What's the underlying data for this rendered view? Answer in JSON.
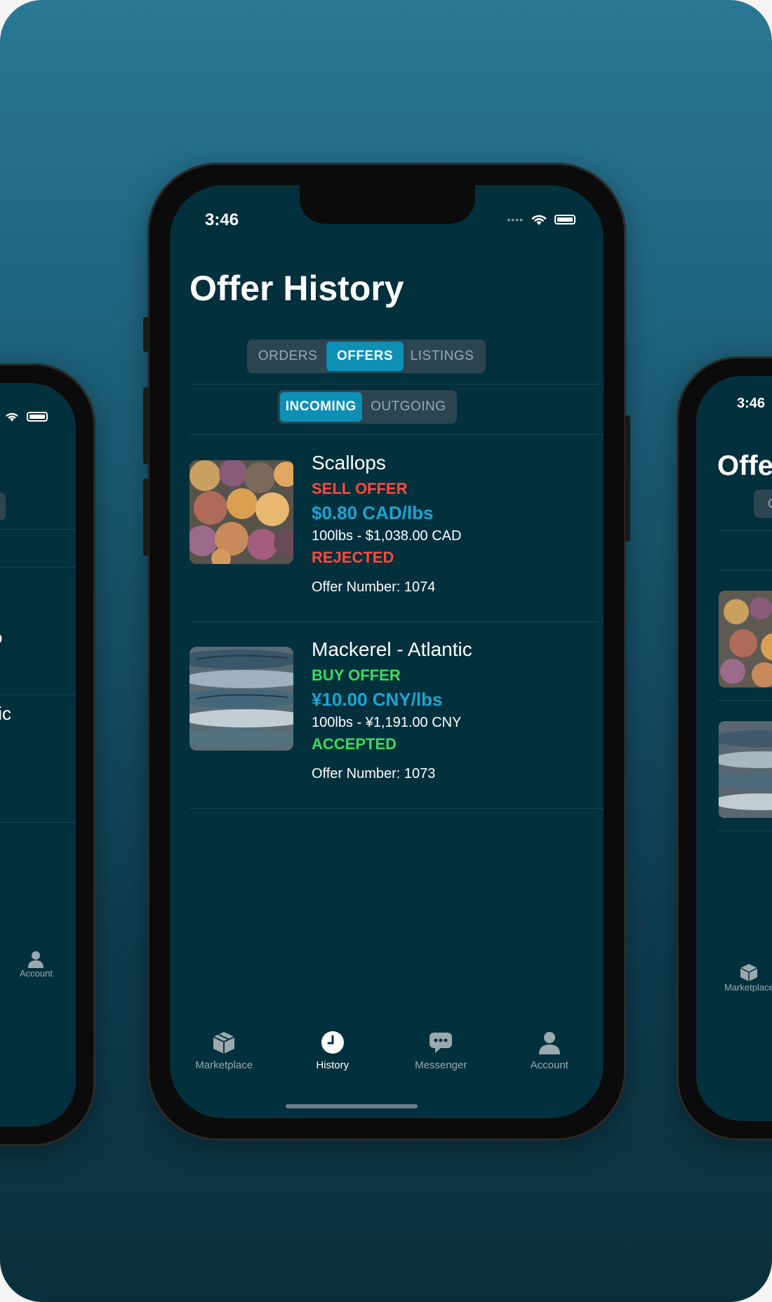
{
  "status": {
    "time": "3:46"
  },
  "page": {
    "title": "Offer History"
  },
  "tabs_main": [
    {
      "label": "ORDERS",
      "active": false
    },
    {
      "label": "OFFERS",
      "active": true
    },
    {
      "label": "LISTINGS",
      "active": false
    }
  ],
  "tabs_sub": [
    {
      "label": "INCOMING",
      "active": true
    },
    {
      "label": "OUTGOING",
      "active": false
    }
  ],
  "offers": [
    {
      "product": "Scallops",
      "type": "SELL OFFER",
      "price": "$0.80 CAD/lbs",
      "quantity": "100lbs - $1,038.00 CAD",
      "status": "REJECTED",
      "number": "Offer Number: 1074",
      "type_color": "#ff4b3e",
      "status_color": "#ff4b3e"
    },
    {
      "product": "Mackerel - Atlantic",
      "type": "BUY OFFER",
      "price": "¥10.00 CNY/lbs",
      "quantity": "100lbs - ¥1,191.00 CNY",
      "status": "ACCEPTED",
      "number": "Offer Number: 1073",
      "type_color": "#3ddb5a",
      "status_color": "#3ddb5a"
    }
  ],
  "tabbar": [
    {
      "label": "Marketplace",
      "icon": "box-icon",
      "active": false
    },
    {
      "label": "History",
      "icon": "clock-icon",
      "active": true
    },
    {
      "label": "Messenger",
      "icon": "chat-icon",
      "active": false
    },
    {
      "label": "Account",
      "icon": "person-icon",
      "active": false
    }
  ],
  "left_phone": {
    "frag1": "S",
    "frag2": "o",
    "frag3": "tic",
    "frag4": "/",
    "tab_label": "Account"
  },
  "right_phone": {
    "time": "3:46",
    "title_fragment": "Offer",
    "seg_fragment": "C",
    "tab_label": "Marketplace"
  },
  "colors": {
    "accent": "#0e8fb6",
    "price": "#1aa5d2",
    "rejected": "#ff4b3e",
    "accepted": "#3ddb5a",
    "screen_bg": "#03303d"
  }
}
